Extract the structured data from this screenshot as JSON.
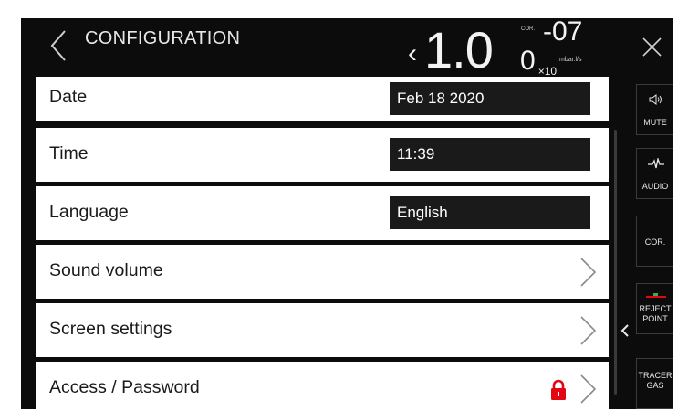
{
  "header": {
    "title": "CONFIGURATION",
    "reading": {
      "prefix": "‹",
      "mantissa": "1.0",
      "mantissa_small_digit": "0",
      "corr_label": "COR.",
      "exponent": "-07",
      "multiplier": "×10",
      "unit": "mbar.l/s"
    }
  },
  "rows": [
    {
      "label": "Date",
      "value": "Feb 18 2020"
    },
    {
      "label": "Time",
      "value": "11:39"
    },
    {
      "label": "Language",
      "value": "English"
    },
    {
      "label": "Sound volume"
    },
    {
      "label": "Screen settings"
    },
    {
      "label": "Access / Password",
      "locked": true
    }
  ],
  "sidebar": {
    "mute": "MUTE",
    "audio": "AUDIO",
    "cor": "COR.",
    "reject_line1": "REJECT",
    "reject_line2": "POINT",
    "tracer_line1": "TRACER",
    "tracer_line2": "GAS"
  },
  "colors": {
    "background": "#0c0c0c",
    "row": "#ffffff",
    "value_box": "#1a1a1a",
    "lock": "#e30613",
    "reject_green": "#3fae49",
    "reject_red": "#e30613"
  }
}
